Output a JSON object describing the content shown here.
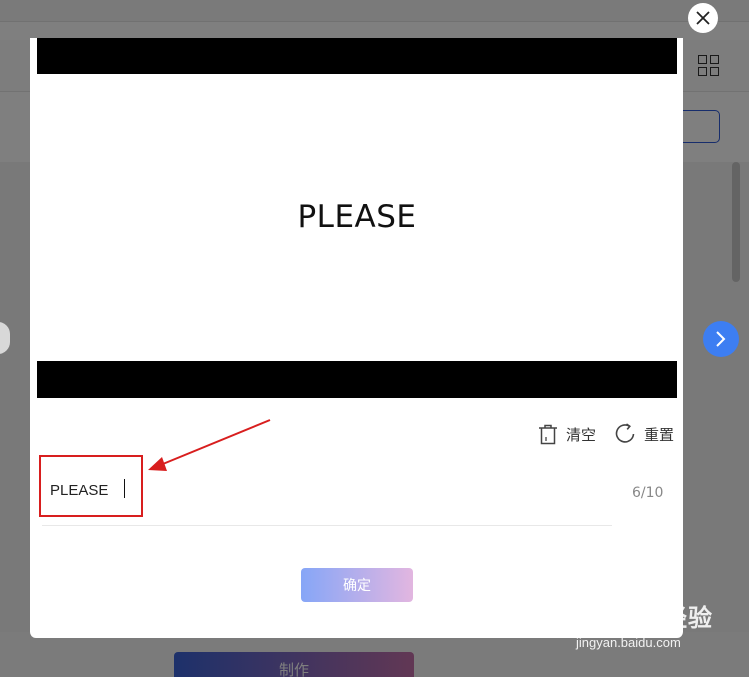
{
  "preview": {
    "text": "PLEASE"
  },
  "actions": {
    "clear_label": "清空",
    "reset_label": "重置"
  },
  "input": {
    "value": "PLEASE",
    "counter": "6/10"
  },
  "confirm": {
    "label": "确定"
  },
  "background": {
    "make_button_label": "制作"
  },
  "watermark": {
    "logo": "Bai du 经验",
    "url": "jingyan.baidu.com"
  },
  "colors": {
    "accent_blue": "#3d7ef2",
    "annotation_red": "#d81e1e",
    "gradient_start": "#86a6f7",
    "gradient_end": "#e2b6e0"
  },
  "icons": {
    "close": "close-icon",
    "next": "chevron-right-icon",
    "clear": "trash-icon",
    "reset": "refresh-icon",
    "view": "grid-icon"
  }
}
